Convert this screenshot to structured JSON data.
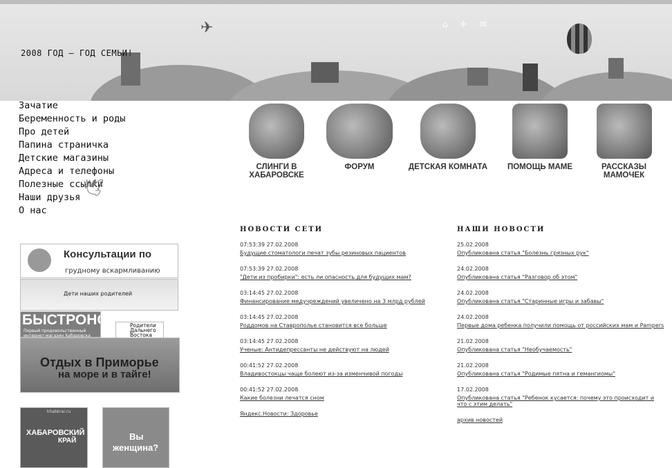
{
  "header": {
    "slogan": "2008 ГОД – ГОД СЕМЬИ!",
    "icons": [
      "home-icon",
      "compass-icon",
      "mail-icon"
    ]
  },
  "nav": {
    "items": [
      {
        "label": "Зачатие"
      },
      {
        "label": "Беременность и роды"
      },
      {
        "label": "Про детей"
      },
      {
        "label": "Папина страничка"
      },
      {
        "label": "Детские магазины"
      },
      {
        "label": "Адреса и телефоны"
      },
      {
        "label": "Полезные ссылки"
      },
      {
        "label": "Наши друзья"
      },
      {
        "label": "О нас"
      }
    ]
  },
  "categories": [
    {
      "label": "СЛИНГИ В ХАБАРОВСКЕ"
    },
    {
      "label": "ФОРУМ"
    },
    {
      "label": "ДЕТСКАЯ КОМНАТА"
    },
    {
      "label": "ПОМОЩЬ МАМЕ"
    },
    {
      "label": "РАССКАЗЫ МАМОЧЕК"
    }
  ],
  "network_news": {
    "title": "НОВОСТИ СЕТИ",
    "items": [
      {
        "date": "07:53:39 27.02.2008",
        "text": "Будущие стоматологи печат зубы резиновых пациентов"
      },
      {
        "date": "07:53:39 27.02.2008",
        "text": "\"Дети из пробирки\": есть ли опасность для будущих мам?"
      },
      {
        "date": "03:14:45 27.02.2008",
        "text": "Финансирование медучреждений увеличено на 3 млрд рублей"
      },
      {
        "date": "03:14:45 27.02.2008",
        "text": "Роддомов на Ставрополье становится все больше"
      },
      {
        "date": "03:14:45 27.02.2008",
        "text": "Ученые: Антидепрессанты не действуют на людей"
      },
      {
        "date": "00:41:52 27.02.2008",
        "text": "Владивостокцы чаще болеют из-за изменчивой погоды"
      },
      {
        "date": "00:41:52 27.02.2008",
        "text": "Какие болезни лечатся сном"
      }
    ],
    "footer": "Яндекс.Новости: Здоровье"
  },
  "our_news": {
    "title": "НАШИ НОВОСТИ",
    "items": [
      {
        "date": "25.02.2008",
        "text": "Опубликована статья \"Болезнь грязных рук\""
      },
      {
        "date": "24.02.2008",
        "text": "Опубликована статья \"Разговор об этом\""
      },
      {
        "date": "24.02.2008",
        "text": "Опубликована статья \"Старинные игры и забавы\""
      },
      {
        "date": "24.02.2008",
        "text": "Первые дома ребенка получили помощь от российских мам и Pampers"
      },
      {
        "date": "21.02.2008",
        "text": "Опубликована статья \"Необучаемость\""
      },
      {
        "date": "21.02.2008",
        "text": "Опубликована статья \"Родимые пятна и гемангиомы\""
      },
      {
        "date": "17.02.2008",
        "text": "Опубликована статья \"Ребенок кусается: почему это происходит и что с этим делать\""
      }
    ],
    "footer": "архив новостей"
  },
  "banners": {
    "consult_title": "Консультации по",
    "consult_sub": "грудному вскармливанию",
    "parents": "Дети наших родителей",
    "bystronom_title": "БЫСТРОНОМ",
    "bystronom_sub": "Первый продовольственный интернет-магазин Хабаровска",
    "far_east": "Родители Дальнего Востока",
    "rest_title": "Отдых в Приморье",
    "rest_sub": "на море и в тайге!",
    "khab_site": "khabkrai.ru",
    "khab_title": "ХАБАРОВСКИЙ",
    "khab_sub": "КРАЙ",
    "woman_1": "Вы",
    "woman_2": "женщина?"
  }
}
